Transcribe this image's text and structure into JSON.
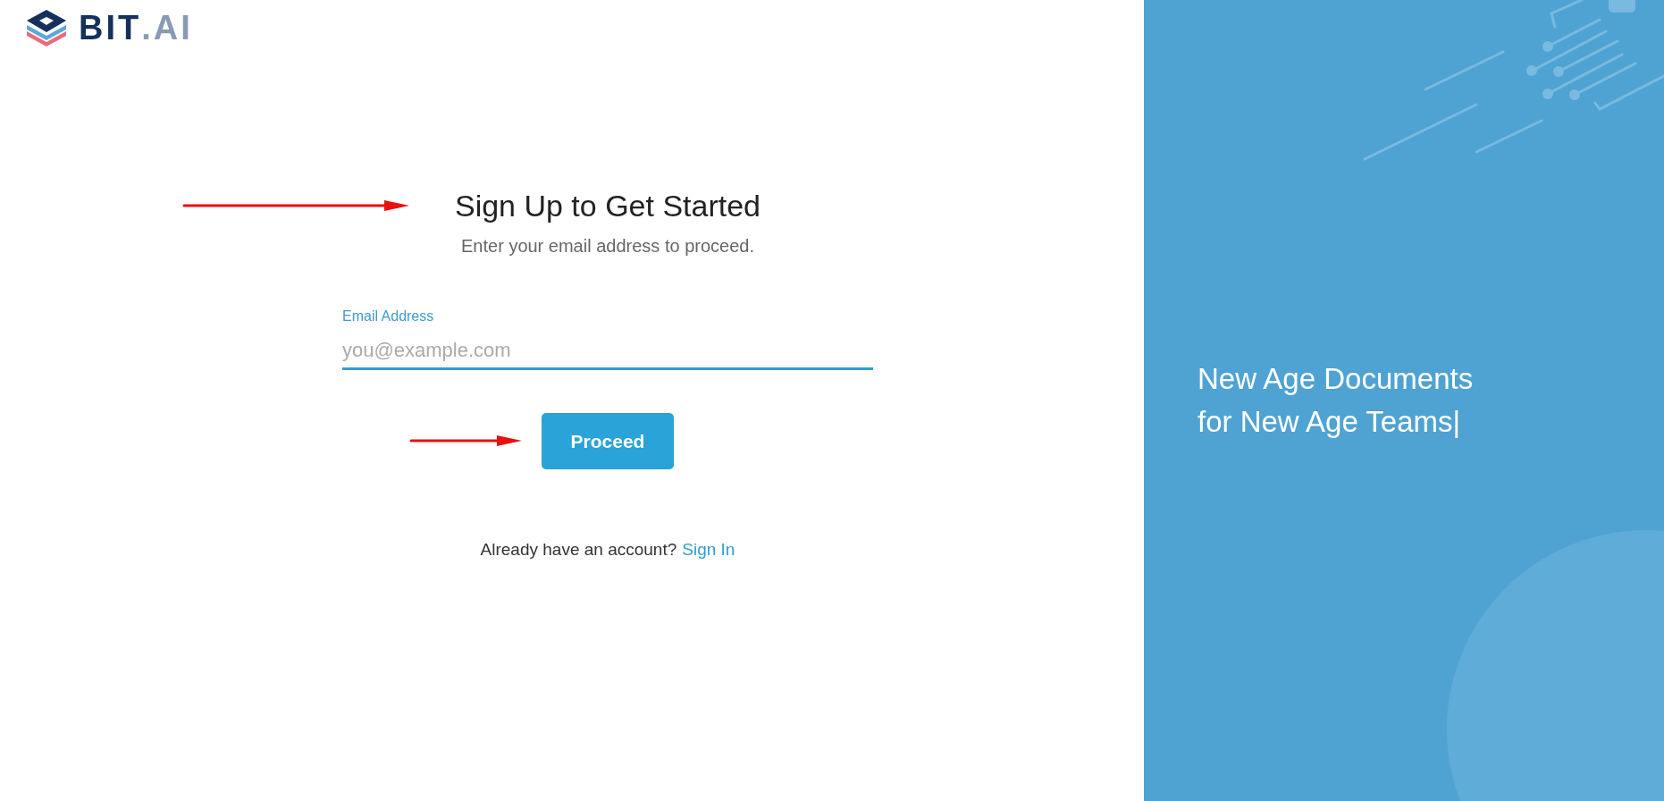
{
  "logo": {
    "name": "BIT",
    "suffix": ".AI"
  },
  "heading": "Sign Up to Get Started",
  "subtitle": "Enter your email address to proceed.",
  "email_field": {
    "label": "Email Address",
    "placeholder": "you@example.com"
  },
  "primary_button": "Proceed",
  "signin": {
    "prompt": "Already have an account?",
    "link": "Sign In"
  },
  "hero": {
    "lines": [
      "New Age Documents",
      "for New Age Teams|"
    ]
  }
}
